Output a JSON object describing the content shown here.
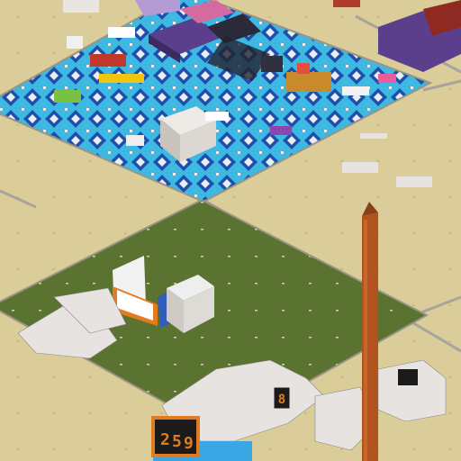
{
  "world": {
    "scoreboard_digits": [
      "2",
      "5",
      "9"
    ],
    "small_sign_digit": "8"
  },
  "colors": {
    "sand": "#dacd9a",
    "sand_grid": "#c9bb86",
    "path": "#a7a59b",
    "grass": "#5b7330",
    "grass_dark": "#4d642a",
    "tile_light": "#3cb8e3",
    "tile_dark": "#1f4fa8",
    "tile_white": "#e8eef2",
    "purple": "#5b3f8c",
    "tower": "#b0531e",
    "build_white": "#e6e3e0",
    "build_red": "#8e2a22",
    "score_bg": "#1b1b1b",
    "score_frame": "#e07b20"
  },
  "icons": {
    "scoreboard": "scoreboard-icon",
    "tower": "tower-icon"
  }
}
